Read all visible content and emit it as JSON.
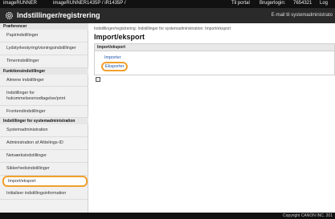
{
  "topbar": {
    "device_name": "imageRUNNER",
    "model": "imageRUNNER1435P / iR1435P /",
    "portal": "Til portal",
    "login_label": "Brugerlogin:",
    "user_id": "7654321",
    "logout": "Log"
  },
  "header": {
    "title": "Indstillinger/registrering",
    "email": "E-mail til systemadministrato"
  },
  "sidebar": {
    "sections": [
      "Præferencer",
      "Funktionsindstillinger",
      "Indstillinger for systemadministration"
    ],
    "items": [
      "Papirindstillinger",
      "Lydstyrkestyring/visningsindstillinger",
      "Timerindstillinger",
      "Almene indstillinger",
      "Indstillinger for",
      "hukommelsesmodtagelse/print",
      "Frontendindstillinger",
      "Systemadministration",
      "Administration af Afdelings-ID",
      "Netværksindstillinger",
      "Sikkerhedsindstillinger",
      "Import/eksport",
      "Initialiser indstillingsinformation"
    ]
  },
  "main": {
    "breadcrumb": "Indstillinger/registrering: Indstillinger for systemadministration: Import/eksport",
    "title": "Import/eksport",
    "panel_header": "Import/eksport",
    "import_link": "Importer",
    "export_link": "Eksporter"
  },
  "footer": {
    "copyright": "Copyright CANON INC. 201"
  },
  "colors": {
    "highlight": "#f0a02c",
    "link": "#1a52a8",
    "header_bg": "#2a2a2a"
  }
}
